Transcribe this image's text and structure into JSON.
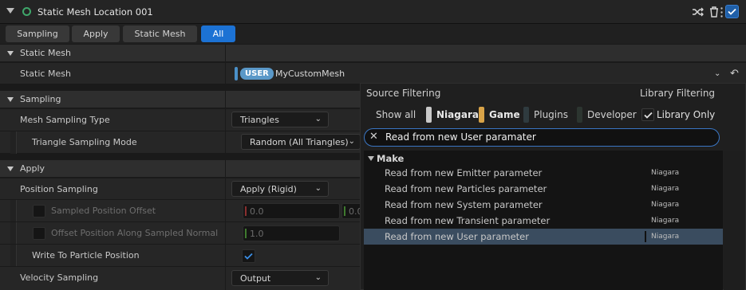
{
  "titlebar": {
    "title": "Static Mesh Location 001",
    "icons": [
      "shuffle-icon",
      "trash-icon",
      "more-vertical-icon"
    ],
    "enabled": true
  },
  "filters": [
    {
      "label": "Sampling",
      "active": false
    },
    {
      "label": "Apply",
      "active": false
    },
    {
      "label": "Static Mesh",
      "active": false
    },
    {
      "label": "All",
      "active": true
    }
  ],
  "sections": {
    "static_mesh": "Static Mesh",
    "sampling": "Sampling",
    "apply": "Apply"
  },
  "props": {
    "static_mesh_label": "Static Mesh",
    "static_mesh_badge": "USER",
    "static_mesh_value": "MyCustomMesh",
    "mesh_sampling_type_label": "Mesh Sampling Type",
    "mesh_sampling_type_value": "Triangles",
    "triangle_sampling_mode_label": "Triangle Sampling Mode",
    "triangle_sampling_mode_value": "Random (All Triangles)",
    "position_sampling_label": "Position Sampling",
    "position_sampling_value": "Apply (Rigid)",
    "sampled_position_offset_label": "Sampled Position Offset",
    "sampled_position_offset_x": "0.0",
    "sampled_position_offset_y": "0.0",
    "offset_along_normal_label": "Offset Position Along Sampled Normal",
    "offset_along_normal_value": "1.0",
    "write_to_particle_position_label": "Write To Particle Position",
    "write_to_particle_position_checked": true,
    "velocity_sampling_label": "Velocity Sampling",
    "velocity_sampling_value": "Output"
  },
  "popup": {
    "source_filtering": "Source Filtering",
    "library_filtering": "Library Filtering",
    "show_all": "Show all",
    "chips": [
      {
        "label": "Niagara",
        "color": "#c9c9c9",
        "bold": true
      },
      {
        "label": "Game",
        "color": "#d8a348",
        "bold": true
      },
      {
        "label": "Plugins",
        "color": "#2f3b3f",
        "bold": false
      },
      {
        "label": "Developer",
        "color": "#2c3530",
        "bold": false
      }
    ],
    "library_only": "Library Only",
    "library_only_checked": true,
    "search_value": "Read from new User paramater",
    "category": "Make",
    "items": [
      {
        "label": "Read from new Emitter parameter",
        "source": "Niagara",
        "selected": false
      },
      {
        "label": "Read from new Particles parameter",
        "source": "Niagara",
        "selected": false
      },
      {
        "label": "Read from new System parameter",
        "source": "Niagara",
        "selected": false
      },
      {
        "label": "Read from new Transient parameter",
        "source": "Niagara",
        "selected": false
      },
      {
        "label": "Read from new User parameter",
        "source": "Niagara",
        "selected": true
      }
    ]
  },
  "colors": {
    "accent": "#1c72d4",
    "user_badge": "#4a90c8",
    "selection": "#3a4c5f"
  }
}
